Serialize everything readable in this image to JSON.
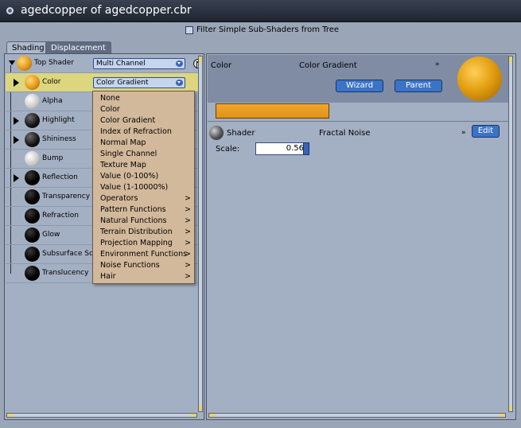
{
  "window": {
    "title": "agedcopper of agedcopper.cbr"
  },
  "filter": {
    "label": "Filter Simple Sub-Shaders from Tree",
    "checked": false
  },
  "tabs": [
    {
      "label": "Shading",
      "active": true
    },
    {
      "label": "Displacement",
      "active": false
    }
  ],
  "tree": {
    "root": {
      "label": "Top Shader",
      "dropdown": "Multi Channel"
    },
    "items": [
      {
        "label": "Color",
        "dropdown": "Color Gradient",
        "selected": true,
        "expandable": true
      },
      {
        "label": "Alpha",
        "expandable": false
      },
      {
        "label": "Highlight",
        "expandable": true
      },
      {
        "label": "Shininess",
        "expandable": true
      },
      {
        "label": "Bump",
        "expandable": false
      },
      {
        "label": "Reflection",
        "expandable": true
      },
      {
        "label": "Transparency",
        "expandable": false
      },
      {
        "label": "Refraction",
        "expandable": false
      },
      {
        "label": "Glow",
        "expandable": false
      },
      {
        "label": "Subsurface Sc",
        "expandable": false
      },
      {
        "label": "Translucency",
        "expandable": false
      }
    ]
  },
  "menu": {
    "items": [
      {
        "label": "None",
        "submenu": false
      },
      {
        "label": "Color",
        "submenu": false
      },
      {
        "label": "Color Gradient",
        "submenu": false
      },
      {
        "label": "Index of Refraction",
        "submenu": false
      },
      {
        "label": "Normal Map",
        "submenu": false
      },
      {
        "label": "Single Channel",
        "submenu": false
      },
      {
        "label": "Texture Map",
        "submenu": false
      },
      {
        "label": "Value (0-100%)",
        "submenu": false
      },
      {
        "label": "Value (1-10000%)",
        "submenu": false
      },
      {
        "label": "Operators",
        "submenu": true
      },
      {
        "label": "Pattern Functions",
        "submenu": true
      },
      {
        "label": "Natural Functions",
        "submenu": true
      },
      {
        "label": "Terrain Distribution",
        "submenu": true
      },
      {
        "label": "Projection Mapping",
        "submenu": true
      },
      {
        "label": "Environment Functions",
        "submenu": true
      },
      {
        "label": "Noise Functions",
        "submenu": true
      },
      {
        "label": "Hair",
        "submenu": true
      }
    ],
    "submenu_glyph": ">"
  },
  "detail": {
    "channel": "Color",
    "type": "Color Gradient",
    "chevron": "»",
    "wizard_label": "Wizard",
    "parent_label": "Parent",
    "shader_label": "Shader",
    "shader_value": "Fractal Noise",
    "edit_label": "Edit",
    "scale_label": "Scale:",
    "scale_value": "0.56"
  },
  "colors": {
    "accent_orange": "#e59a18",
    "selected_row": "#dcd67e",
    "menu_bg": "#d3b99b",
    "button_blue": "#3b73c7"
  }
}
